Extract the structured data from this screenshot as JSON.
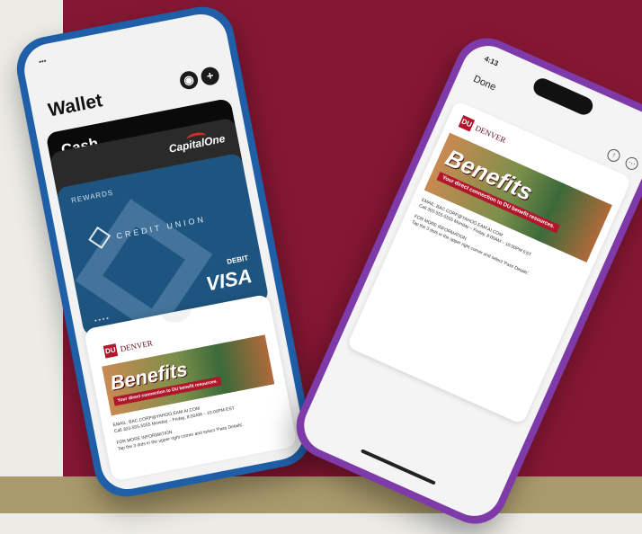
{
  "phone_left": {
    "wallet_title": "Wallet",
    "apple_cash_label": "Cash",
    "capital_one_label": "CapitalOne",
    "rewards_label": "REWARDS",
    "credit_union_label": "CREDIT UNION",
    "debit_label": "DEBIT",
    "visa_label": "VISA",
    "card_dots": "••••",
    "pass": {
      "university_label": "DENVER",
      "banner_title": "Benefits",
      "banner_tag": "Your direct connection to DU benefit resources.",
      "email_line": "EMAIL: BAC.CORP@YAHOO.EAM.AI.COM",
      "call_line": "Call 303-555-5555 Monday – Friday, 8:00AM – 10:00PM EST",
      "more_info_header": "FOR MORE INFORMATION",
      "more_info_text": "Tap the 3 dots in the upper right corner and select 'Pass Details'."
    }
  },
  "phone_right": {
    "status_time": "4:13",
    "done_label": "Done",
    "pass": {
      "university_label": "DENVER",
      "banner_title": "Benefits",
      "banner_tag": "Your direct connection to DU benefit resources.",
      "email_line": "EMAIL: BAC.CORP@YAHOO.EAM.AI.COM",
      "call_line": "Call 303-555-5555 Monday – Friday, 8:00AM – 10:00PM EST",
      "more_info_header": "FOR MORE INFORMATION",
      "more_info_text": "Tap the 3 dots in the upper right corner and select 'Pass Details'."
    }
  },
  "colors": {
    "maroon": "#861733",
    "gold": "#a99a6c",
    "blue_phone": "#1f5fa8",
    "purple_phone": "#7d3aa8"
  }
}
